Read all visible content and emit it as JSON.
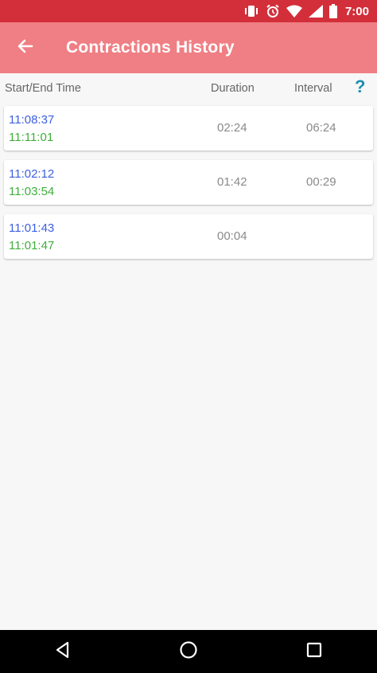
{
  "status_bar": {
    "time": "7:00",
    "icons": [
      "vibrate-icon",
      "alarm-icon",
      "wifi-icon",
      "signal-icon",
      "battery-icon"
    ],
    "background": "#d32f3a"
  },
  "app_bar": {
    "title": "Contractions History",
    "background": "#ef7f84",
    "back_icon": "arrow-back-icon"
  },
  "columns": {
    "start_end": "Start/End Time",
    "duration": "Duration",
    "interval": "Interval",
    "help": "?"
  },
  "rows": [
    {
      "start": "11:08:37",
      "end": "11:11:01",
      "duration": "02:24",
      "interval": "06:24"
    },
    {
      "start": "11:02:12",
      "end": "11:03:54",
      "duration": "01:42",
      "interval": "00:29"
    },
    {
      "start": "11:01:43",
      "end": "11:01:47",
      "duration": "00:04",
      "interval": ""
    }
  ],
  "colors": {
    "start_time": "#3d5fe0",
    "end_time": "#3fae3a",
    "help": "#1b8fb1"
  },
  "nav_bar": {
    "icons": [
      "back-triangle-icon",
      "home-circle-icon",
      "recents-square-icon"
    ]
  }
}
